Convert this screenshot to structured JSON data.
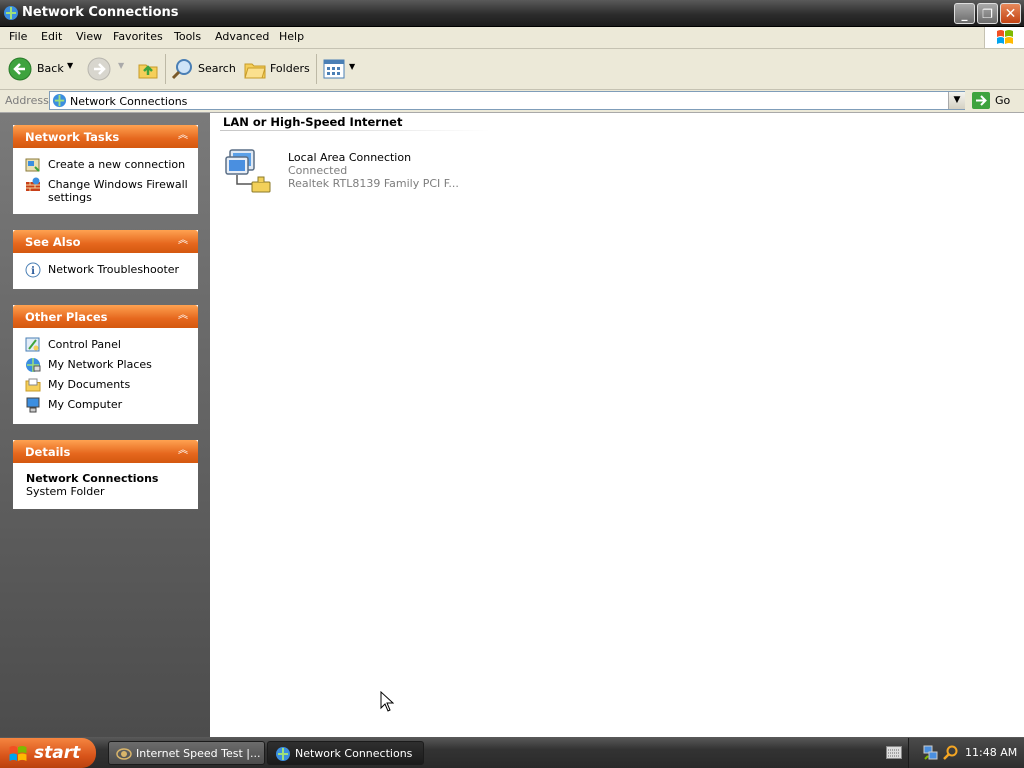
{
  "window": {
    "title": "Network Connections",
    "icon": "network-connections-icon"
  },
  "menu": [
    "File",
    "Edit",
    "View",
    "Favorites",
    "Tools",
    "Advanced",
    "Help"
  ],
  "toolbar": {
    "back_label": "Back",
    "search_label": "Search",
    "folders_label": "Folders"
  },
  "address": {
    "label": "Address",
    "value": "Network Connections",
    "go_label": "Go"
  },
  "sidebar": {
    "network_tasks": {
      "title": "Network Tasks",
      "items": [
        {
          "label": "Create a new connection",
          "icon": "new-connection-icon"
        },
        {
          "label": "Change Windows Firewall settings",
          "icon": "firewall-icon"
        }
      ]
    },
    "see_also": {
      "title": "See Also",
      "items": [
        {
          "label": "Network Troubleshooter",
          "icon": "info-icon"
        }
      ]
    },
    "other_places": {
      "title": "Other Places",
      "items": [
        {
          "label": "Control Panel",
          "icon": "control-panel-icon"
        },
        {
          "label": "My Network Places",
          "icon": "network-places-icon"
        },
        {
          "label": "My Documents",
          "icon": "documents-icon"
        },
        {
          "label": "My Computer",
          "icon": "computer-icon"
        }
      ]
    },
    "details": {
      "title": "Details",
      "name": "Network Connections",
      "type": "System Folder"
    }
  },
  "content": {
    "group_title": "LAN or High-Speed Internet",
    "connection": {
      "name": "Local Area Connection",
      "status": "Connected",
      "device": "Realtek RTL8139 Family PCI F..."
    }
  },
  "taskbar": {
    "start_label": "start",
    "tasks": [
      {
        "label": "Internet Speed Test |...",
        "icon": "browser-icon"
      },
      {
        "label": "Network Connections",
        "icon": "network-connections-icon"
      }
    ],
    "clock": "11:48 AM"
  },
  "colors": {
    "panel_header": "#e5671d",
    "left_pane": "#5c5c5c",
    "link_text": "#000000"
  }
}
